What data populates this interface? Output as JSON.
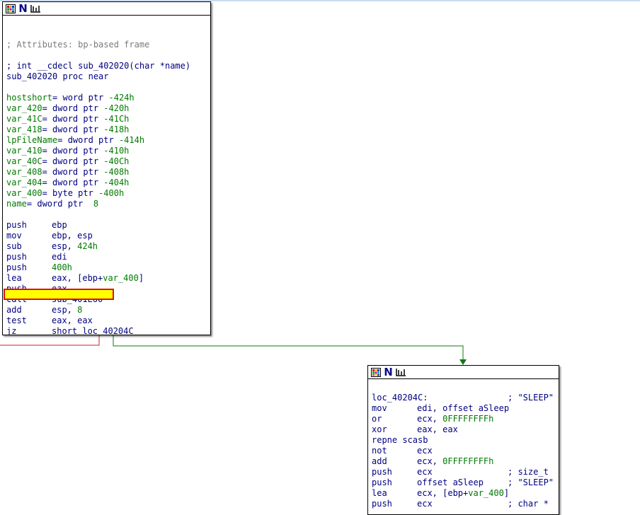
{
  "colors": {
    "edge_false": "#cc2222",
    "edge_true": "#117711",
    "highlight_fill": "#ffff00",
    "highlight_border": "#e01010"
  },
  "node_icons": [
    "color-grid-icon",
    "n-letter-icon",
    "graph-layout-icon"
  ],
  "node1": {
    "header_glyph": "N",
    "lines": [
      {
        "type": "blank"
      },
      {
        "type": "blank"
      },
      {
        "type": "comment",
        "text": "; Attributes: bp-based frame"
      },
      {
        "type": "blank"
      },
      {
        "type": "comment_blue",
        "text": "; int __cdecl sub_402020(char *name)"
      },
      {
        "type": "plain",
        "text": "sub_402020 proc near"
      },
      {
        "type": "blank"
      },
      {
        "type": "var",
        "name": "hostshort",
        "rest": "= word ptr ",
        "val": "-424h"
      },
      {
        "type": "var",
        "name": "var_420",
        "rest": "= dword ptr ",
        "val": "-420h"
      },
      {
        "type": "var",
        "name": "var_41C",
        "rest": "= dword ptr ",
        "val": "-41Ch"
      },
      {
        "type": "var",
        "name": "var_418",
        "rest": "= dword ptr ",
        "val": "-418h"
      },
      {
        "type": "var",
        "name": "lpFileName",
        "rest": "= dword ptr ",
        "val": "-414h"
      },
      {
        "type": "var",
        "name": "var_410",
        "rest": "= dword ptr ",
        "val": "-410h"
      },
      {
        "type": "var",
        "name": "var_40C",
        "rest": "= dword ptr ",
        "val": "-40Ch"
      },
      {
        "type": "var",
        "name": "var_408",
        "rest": "= dword ptr ",
        "val": "-408h"
      },
      {
        "type": "var",
        "name": "var_404",
        "rest": "= dword ptr ",
        "val": "-404h"
      },
      {
        "type": "var",
        "name": "var_400",
        "rest": "= byte ptr ",
        "val": "-400h"
      },
      {
        "type": "var",
        "name": "name",
        "rest": "= dword ptr  ",
        "val": "8"
      },
      {
        "type": "blank"
      },
      {
        "type": "ins",
        "op": "push",
        "args": [
          {
            "t": "ebp"
          }
        ]
      },
      {
        "type": "ins",
        "op": "mov",
        "args": [
          {
            "t": "ebp, esp"
          }
        ]
      },
      {
        "type": "ins",
        "op": "sub",
        "args": [
          {
            "t": "esp, "
          },
          {
            "t": "424h",
            "c": "grn"
          }
        ]
      },
      {
        "type": "ins",
        "op": "push",
        "args": [
          {
            "t": "edi"
          }
        ]
      },
      {
        "type": "ins",
        "op": "push",
        "args": [
          {
            "t": "400h",
            "c": "grn"
          }
        ]
      },
      {
        "type": "ins",
        "op": "lea",
        "args": [
          {
            "t": "eax, [ebp+"
          },
          {
            "t": "var_400",
            "c": "grn"
          },
          {
            "t": "]"
          }
        ]
      },
      {
        "type": "ins",
        "op": "push",
        "args": [
          {
            "t": "eax"
          }
        ]
      },
      {
        "type": "ins",
        "op": "call",
        "args": [
          {
            "t": "sub_401E60"
          }
        ]
      },
      {
        "type": "ins",
        "op": "add",
        "args": [
          {
            "t": "esp, "
          },
          {
            "t": "8",
            "c": "grn"
          }
        ]
      },
      {
        "type": "ins",
        "op": "test",
        "args": [
          {
            "t": "eax, eax"
          }
        ]
      },
      {
        "type": "ins",
        "op": "jz",
        "args": [
          {
            "t": "short loc_40204C"
          }
        ]
      }
    ]
  },
  "node2": {
    "header_glyph": "N",
    "lines": [
      {
        "type": "blank"
      },
      {
        "type": "label",
        "text": "loc_40204C:",
        "comment": "; \"SLEEP\""
      },
      {
        "type": "ins",
        "op": "mov",
        "args": [
          {
            "t": "edi, offset aSleep"
          }
        ]
      },
      {
        "type": "ins",
        "op": "or",
        "args": [
          {
            "t": "ecx, "
          },
          {
            "t": "0FFFFFFFFh",
            "c": "grn"
          }
        ]
      },
      {
        "type": "ins",
        "op": "xor",
        "args": [
          {
            "t": "eax, eax"
          }
        ]
      },
      {
        "type": "plain",
        "text": "repne scasb"
      },
      {
        "type": "ins",
        "op": "not",
        "args": [
          {
            "t": "ecx"
          }
        ]
      },
      {
        "type": "ins",
        "op": "add",
        "args": [
          {
            "t": "ecx, "
          },
          {
            "t": "0FFFFFFFFh",
            "c": "grn"
          }
        ]
      },
      {
        "type": "ins",
        "op": "push",
        "args": [
          {
            "t": "ecx"
          }
        ],
        "comment": "; size_t"
      },
      {
        "type": "ins",
        "op": "push",
        "args": [
          {
            "t": "offset aSleep"
          }
        ],
        "comment": "; \"SLEEP\""
      },
      {
        "type": "ins",
        "op": "lea",
        "args": [
          {
            "t": "ecx, [ebp+"
          },
          {
            "t": "var_400",
            "c": "grn"
          },
          {
            "t": "]"
          }
        ]
      },
      {
        "type": "ins",
        "op": "push",
        "args": [
          {
            "t": "ecx"
          }
        ],
        "comment": "; char *"
      }
    ]
  }
}
